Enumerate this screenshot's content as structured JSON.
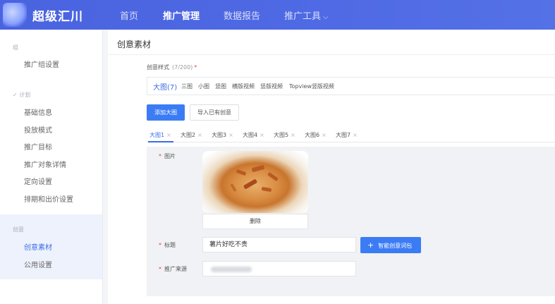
{
  "header": {
    "brand": "超级汇川",
    "nav": [
      {
        "label": "首页",
        "active": false
      },
      {
        "label": "推广管理",
        "active": true
      },
      {
        "label": "数据报告",
        "active": false
      },
      {
        "label": "推广工具",
        "active": false,
        "has_dropdown": true
      }
    ],
    "nav_chevron": "⌵"
  },
  "sidebar": {
    "groups": [
      {
        "label": "组",
        "items": [
          {
            "label": "推广组设置",
            "active": false
          }
        ]
      },
      {
        "label": "✓ 计划",
        "items": [
          {
            "label": "基础信息",
            "active": false
          },
          {
            "label": "投放模式",
            "active": false
          },
          {
            "label": "推广目标",
            "active": false
          },
          {
            "label": "推广对象详情",
            "active": false
          },
          {
            "label": "定向设置",
            "active": false
          },
          {
            "label": "排期和出价设置",
            "active": false
          }
        ]
      },
      {
        "label": "创意",
        "items": [
          {
            "label": "创意素材",
            "active": true
          },
          {
            "label": "公用设置",
            "active": false
          }
        ]
      }
    ]
  },
  "main": {
    "page_title": "创意素材",
    "creative_style": {
      "label": "创意样式",
      "count": "(7/200)",
      "required_mark": "*",
      "types": [
        "大图(7)",
        "三图",
        "小图",
        "竖图",
        "横版视频",
        "竖版视频",
        "Topview竖版视频"
      ],
      "active_type": "大图(7)"
    },
    "actions": {
      "add_label": "添加大图",
      "import_label": "导入已有创意"
    },
    "tabs": [
      "大图1",
      "大图2",
      "大图3",
      "大图4",
      "大图5",
      "大图6",
      "大图7"
    ],
    "active_tab": "大图1",
    "tab_close": "×",
    "form": {
      "image_label": "图片",
      "delete_label": "删除",
      "title_label": "标题",
      "title_value": "薯片好吃不贵",
      "wordpack_label": "智能创意词包",
      "wordpack_plus": "+",
      "source_label": "推广来源",
      "required_mark": "*"
    },
    "accent_color": "#3b7cf5",
    "header_color": "#4a63e0"
  }
}
